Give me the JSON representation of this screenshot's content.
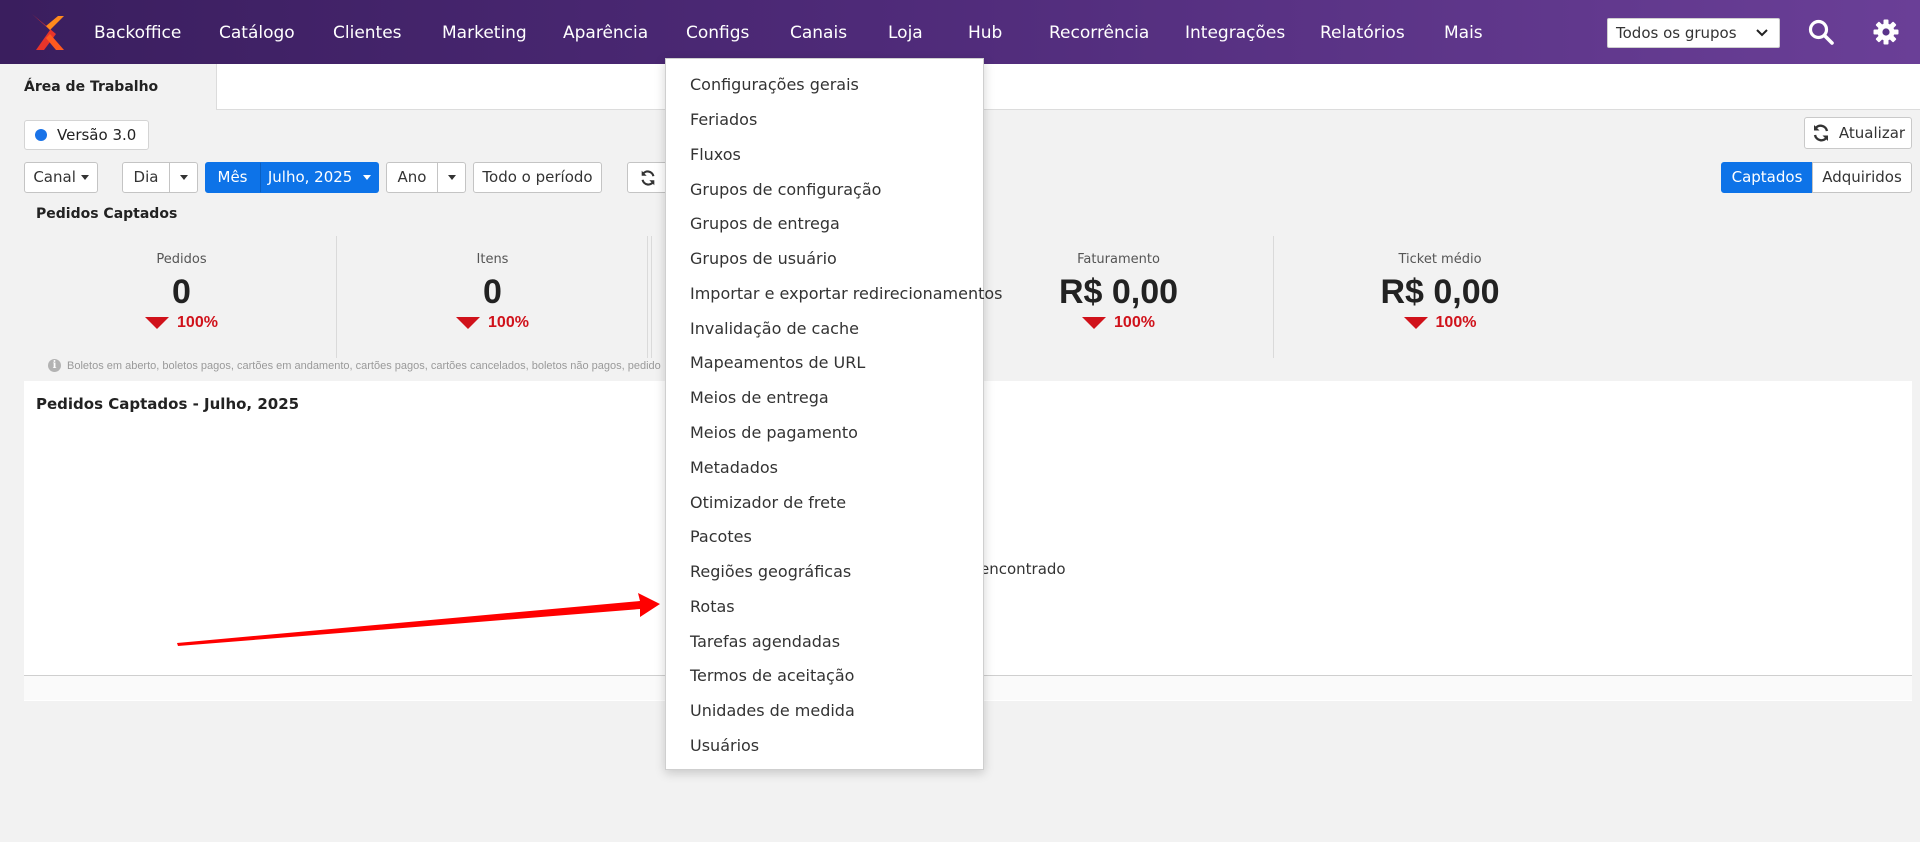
{
  "nav": {
    "items": [
      "Backoffice",
      "Catálogo",
      "Clientes",
      "Marketing",
      "Aparência",
      "Configs",
      "Canais",
      "Loja",
      "Hub",
      "Recorrência",
      "Integrações",
      "Relatórios",
      "Mais"
    ],
    "group_select": "Todos os grupos"
  },
  "tabs": {
    "active": "Área de Trabalho"
  },
  "version": {
    "label": "Versão 3.0"
  },
  "refresh": {
    "label": "Atualizar"
  },
  "filters": {
    "canal": "Canal",
    "dia": "Dia",
    "mes": "Mês",
    "month_value": "Julho, 2025",
    "ano": "Ano",
    "todo": "Todo o período",
    "captados": "Captados",
    "adquiridos": "Adquiridos"
  },
  "summary": {
    "title": "Pedidos Captados",
    "stats": [
      {
        "label": "Pedidos",
        "value": "0",
        "delta": "100%"
      },
      {
        "label": "Itens",
        "value": "0",
        "delta": "100%"
      },
      {
        "label": "Faturamento",
        "value": "R$ 0,00",
        "delta": "100%"
      },
      {
        "label": "Ticket médio",
        "value": "R$ 0,00",
        "delta": "100%"
      }
    ],
    "note": "Boletos em aberto, boletos pagos, cartões em andamento, cartões pagos, cartões cancelados, boletos não pagos, pedido"
  },
  "chart_panel": {
    "title": "Pedidos Captados - Julho, 2025",
    "empty_text": "encontrado"
  },
  "dropdown": {
    "items": [
      "Configurações gerais",
      "Feriados",
      "Fluxos",
      "Grupos de configuração",
      "Grupos de entrega",
      "Grupos de usuário",
      "Importar e exportar redirecionamentos",
      "Invalidação de cache",
      "Mapeamentos de URL",
      "Meios de entrega",
      "Meios de pagamento",
      "Metadados",
      "Otimizador de frete",
      "Pacotes",
      "Regiões geográficas",
      "Rotas",
      "Tarefas agendadas",
      "Termos de aceitação",
      "Unidades de medida",
      "Usuários"
    ]
  },
  "colors": {
    "primary": "#0d73e8",
    "negative": "#d0121b",
    "nav_start": "#3a1e5e",
    "nav_end": "#6a3f97",
    "annotation": "#ff0000"
  },
  "icons": [
    "logo-icon",
    "search-icon",
    "gear-icon",
    "sync-icon",
    "info-icon",
    "chevron-down-icon"
  ]
}
